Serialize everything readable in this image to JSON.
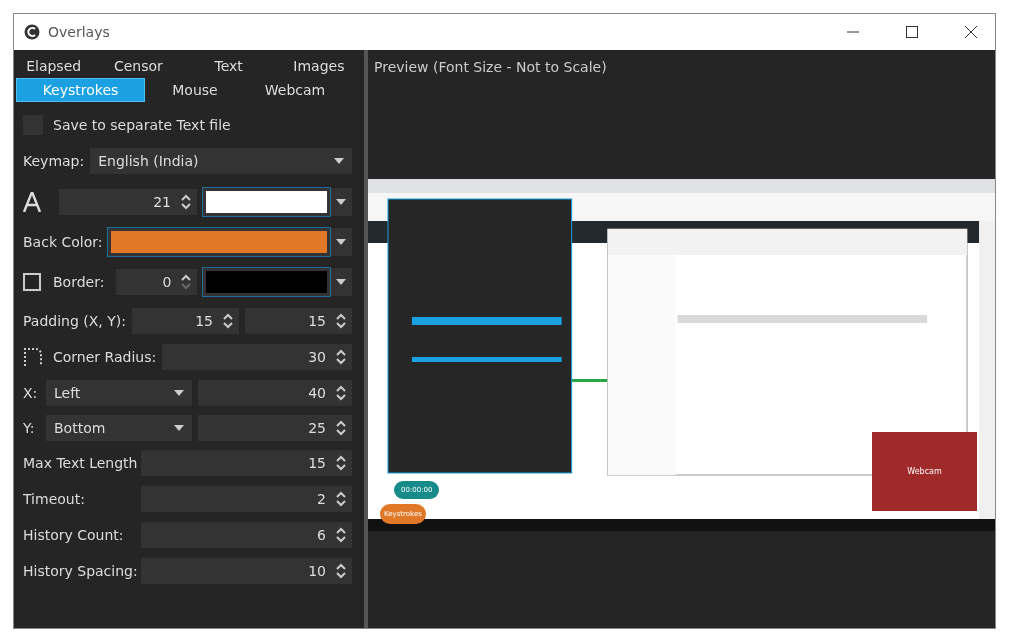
{
  "window": {
    "title": "Overlays"
  },
  "tabs": [
    {
      "label": "Elapsed",
      "selected": false
    },
    {
      "label": "Censor",
      "selected": false
    },
    {
      "label": "Text",
      "selected": false
    },
    {
      "label": "Images",
      "selected": false
    },
    {
      "label": "Keystrokes",
      "selected": true
    },
    {
      "label": "Mouse",
      "selected": false
    },
    {
      "label": "Webcam",
      "selected": false
    }
  ],
  "settings": [
    {
      "kind": "checkbox",
      "label": "Save to separate Text file",
      "checked": false
    },
    {
      "kind": "dropdown",
      "label": "Keymap:",
      "value": "English (India)"
    },
    {
      "kind": "font",
      "value": "21",
      "color": "#ffffff"
    },
    {
      "kind": "color",
      "label": "Back Color:",
      "color": "#e07828"
    },
    {
      "kind": "border",
      "label": "Border:",
      "checked": false,
      "value": "0",
      "color": "#000000"
    },
    {
      "kind": "pair",
      "label": "Padding (X, Y):",
      "values": [
        "15",
        "15"
      ]
    },
    {
      "kind": "corner",
      "label": "Corner Radius:",
      "value": "30"
    },
    {
      "kind": "align",
      "label": "X:",
      "option": "Left",
      "value": "40"
    },
    {
      "kind": "align",
      "label": "Y:",
      "option": "Bottom",
      "value": "25"
    },
    {
      "kind": "number",
      "label": "Max Text Length",
      "value": "15"
    },
    {
      "kind": "number",
      "label": "Timeout:",
      "value": "2"
    },
    {
      "kind": "number",
      "label": "History Count:",
      "value": "6"
    },
    {
      "kind": "number",
      "label": "History Spacing:",
      "value": "10"
    }
  ],
  "preview": {
    "title": "Preview (Font Size - Not to Scale)",
    "timer": "00:00:00",
    "keystrokes": "Keystrokes",
    "webcam": "Webcam"
  }
}
